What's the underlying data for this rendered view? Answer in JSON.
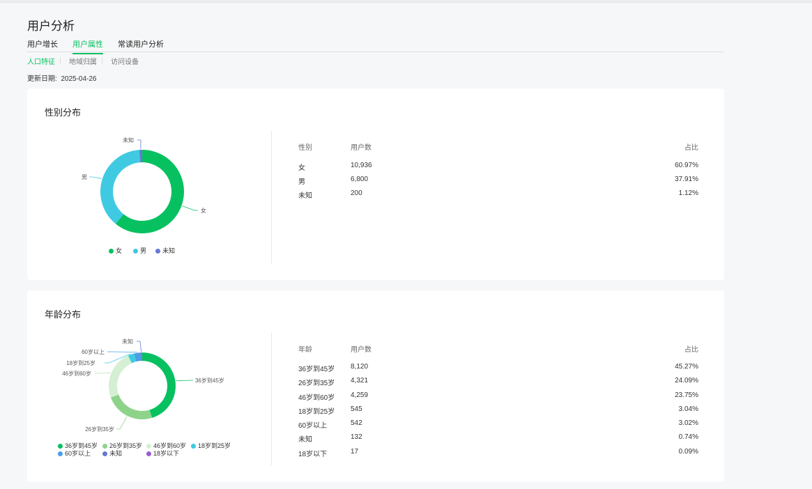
{
  "page": {
    "title": "用户分析"
  },
  "main_tabs": [
    "用户增长",
    "用户属性",
    "常读用户分析"
  ],
  "main_tab_active": "用户属性",
  "sub_tabs": [
    "人口特征",
    "地域归属",
    "访问设备"
  ],
  "sub_tab_active": "人口特征",
  "update": {
    "label": "更新日期:",
    "date": "2025-04-26"
  },
  "gender": {
    "title": "性别分布",
    "headers": [
      "性别",
      "用户数",
      "占比"
    ],
    "rows": [
      {
        "name": "女",
        "count": "10,936",
        "pct": "60.97%",
        "value": 60.97,
        "color": "#07c160"
      },
      {
        "name": "男",
        "count": "6,800",
        "pct": "37.91%",
        "value": 37.91,
        "color": "#3fcae2"
      },
      {
        "name": "未知",
        "count": "200",
        "pct": "1.12%",
        "value": 1.12,
        "color": "#6678d4"
      }
    ]
  },
  "age": {
    "title": "年龄分布",
    "headers": [
      "年龄",
      "用户数",
      "占比"
    ],
    "rows": [
      {
        "name": "36岁到45岁",
        "count": "8,120",
        "pct": "45.27%",
        "value": 45.27,
        "color": "#07c160"
      },
      {
        "name": "26岁到35岁",
        "count": "4,321",
        "pct": "24.09%",
        "value": 24.09,
        "color": "#8ed38a"
      },
      {
        "name": "46岁到60岁",
        "count": "4,259",
        "pct": "23.75%",
        "value": 23.75,
        "color": "#d4efd2"
      },
      {
        "name": "18岁到25岁",
        "count": "545",
        "pct": "3.04%",
        "value": 3.04,
        "color": "#3fcae2"
      },
      {
        "name": "60岁以上",
        "count": "542",
        "pct": "3.02%",
        "value": 3.02,
        "color": "#4a9ee8"
      },
      {
        "name": "未知",
        "count": "132",
        "pct": "0.74%",
        "value": 0.74,
        "color": "#6678d4"
      },
      {
        "name": "18岁以下",
        "count": "17",
        "pct": "0.09%",
        "value": 0.09,
        "color": "#9a5cd6"
      }
    ]
  },
  "chart_data": [
    {
      "type": "pie",
      "title": "性别分布",
      "categories": [
        "女",
        "男",
        "未知"
      ],
      "values": [
        60.97,
        37.91,
        1.12
      ],
      "legend": "bottom"
    },
    {
      "type": "pie",
      "title": "年龄分布",
      "categories": [
        "36岁到45岁",
        "26岁到35岁",
        "46岁到60岁",
        "18岁到25岁",
        "60岁以上",
        "未知",
        "18岁以下"
      ],
      "values": [
        45.27,
        24.09,
        23.75,
        3.04,
        3.02,
        0.74,
        0.09
      ],
      "legend": "bottom"
    }
  ]
}
